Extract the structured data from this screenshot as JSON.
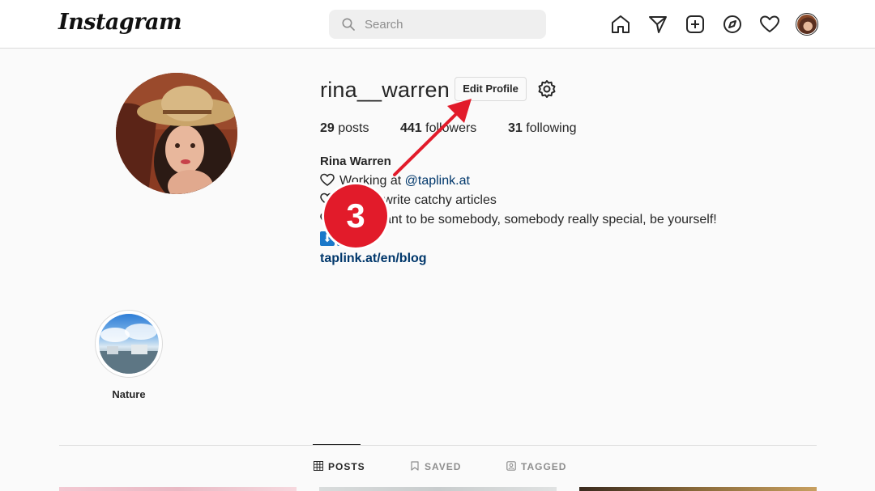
{
  "header": {
    "logo": "Instagram",
    "search_placeholder": "Search",
    "icons": [
      "home-icon",
      "direct-message-icon",
      "new-post-icon",
      "explore-icon",
      "activity-heart-icon",
      "profile-avatar"
    ]
  },
  "profile": {
    "username": "rina__warren",
    "edit_profile_label": "Edit Profile",
    "stats": {
      "posts_count": "29",
      "posts_label": "posts",
      "followers_count": "441",
      "followers_label": "followers",
      "following_count": "31",
      "following_label": "following"
    },
    "full_name": "Rina Warren",
    "bio": {
      "line1_prefix": "Working at ",
      "line1_mention": "@taplink.at",
      "line2": "How to write catchy articles",
      "line3": "If you want to be somebody, somebody really special, be yourself!",
      "emoji_row": [
        "⬇",
        "⬇",
        "⬇"
      ]
    },
    "link": "taplink.at/en/blog"
  },
  "annotation": {
    "step_number": "3",
    "accent_color": "#e21b2a"
  },
  "highlights": [
    {
      "label": "Nature"
    }
  ],
  "tabs": {
    "posts": "POSTS",
    "saved": "SAVED",
    "tagged": "TAGGED",
    "active": "posts"
  },
  "colors": {
    "link": "#00376b",
    "border": "#dbdbdb",
    "background": "#fafafa"
  }
}
